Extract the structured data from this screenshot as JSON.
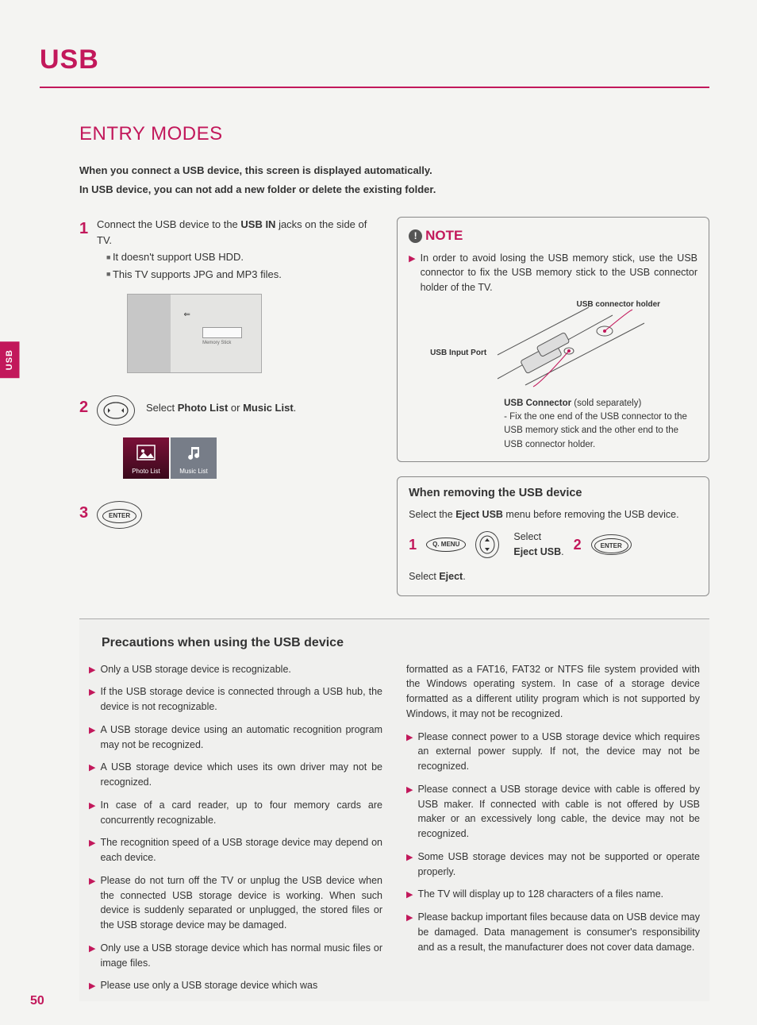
{
  "header": {
    "title": "USB"
  },
  "section": {
    "title": "ENTRY MODES"
  },
  "side_tab": "USB",
  "intro": {
    "line1": "When you connect a USB device, this screen is displayed automatically.",
    "line2": "In USB device, you can not add a new folder or delete the existing folder."
  },
  "steps": {
    "s1": {
      "num": "1",
      "text_a": "Connect the USB device to the ",
      "text_b": "USB IN",
      "text_c": " jacks on the side of TV.",
      "sub1": "It doesn't support USB HDD.",
      "sub2": "This TV supports JPG and MP3 files.",
      "img_label": "Memory Stick"
    },
    "s2": {
      "num": "2",
      "text_a": "Select ",
      "text_b": "Photo List",
      "text_c": " or ",
      "text_d": "Music List",
      "text_e": ".",
      "tile1": "Photo List",
      "tile2": "Music List"
    },
    "s3": {
      "num": "3",
      "btn": "ENTER"
    }
  },
  "note": {
    "title": "NOTE",
    "body": "In order to avoid losing the USB memory stick, use the USB connector to fix the USB memory stick to the USB connector holder of the TV.",
    "label_holder": "USB connector holder",
    "label_port": "USB Input Port",
    "caption_title": "USB Connector",
    "caption_paren": " (sold separately)",
    "caption_body": "- Fix the one end of the USB connector to the USB memory stick and the other end to the USB connector holder."
  },
  "remove": {
    "title": "When removing the USB device",
    "desc_a": "Select the ",
    "desc_b": "Eject USB",
    "desc_c": " menu before removing the USB device.",
    "r1num": "1",
    "r1btn": "Q. MENU",
    "r1sel_a": "Select",
    "r1sel_b": "Eject USB",
    "r1sel_c": ".",
    "r2num": "2",
    "r2btn": "ENTER",
    "r2sel_a": "Select ",
    "r2sel_b": "Eject",
    "r2sel_c": "."
  },
  "precautions": {
    "title": "Precautions when using the USB device",
    "left": [
      "Only a USB storage device is recognizable.",
      "If the USB storage device is connected through a USB hub, the device is not recognizable.",
      "A USB storage device using an automatic recognition program may not be recognized.",
      "A USB storage device which uses its own driver may not be recognized.",
      "In case of a card reader, up to four memory cards are concurrently recognizable.",
      "The recognition speed of a USB storage device may depend on each device.",
      "Please do not turn off the TV or unplug the USB device when the connected USB storage device is working.  When such device is suddenly separated or unplugged, the stored files or the USB storage device may be damaged.",
      "Only use a USB storage device which has normal music files or image files.",
      "Please use only a USB storage device which was"
    ],
    "right_first": "formatted as a FAT16, FAT32 or NTFS file system provided with the Windows operating system.  In case of a storage device formatted as a different utility program which is not supported by Windows, it may not be recognized.",
    "right": [
      "Please connect power to a USB storage device which requires an external power supply.  If not, the device may not be recognized.",
      "Please connect a USB storage device with cable is offered by USB maker.  If connected with cable is not offered by USB maker or an excessively long cable, the device may not be recognized.",
      "Some USB storage devices may not be supported or operate properly.",
      "The TV will display up to 128 characters of a files name.",
      "Please backup important files because data on USB device may be damaged. Data management is consumer's responsibility and as a result, the manufacturer does not cover data damage."
    ]
  },
  "page_number": "50"
}
